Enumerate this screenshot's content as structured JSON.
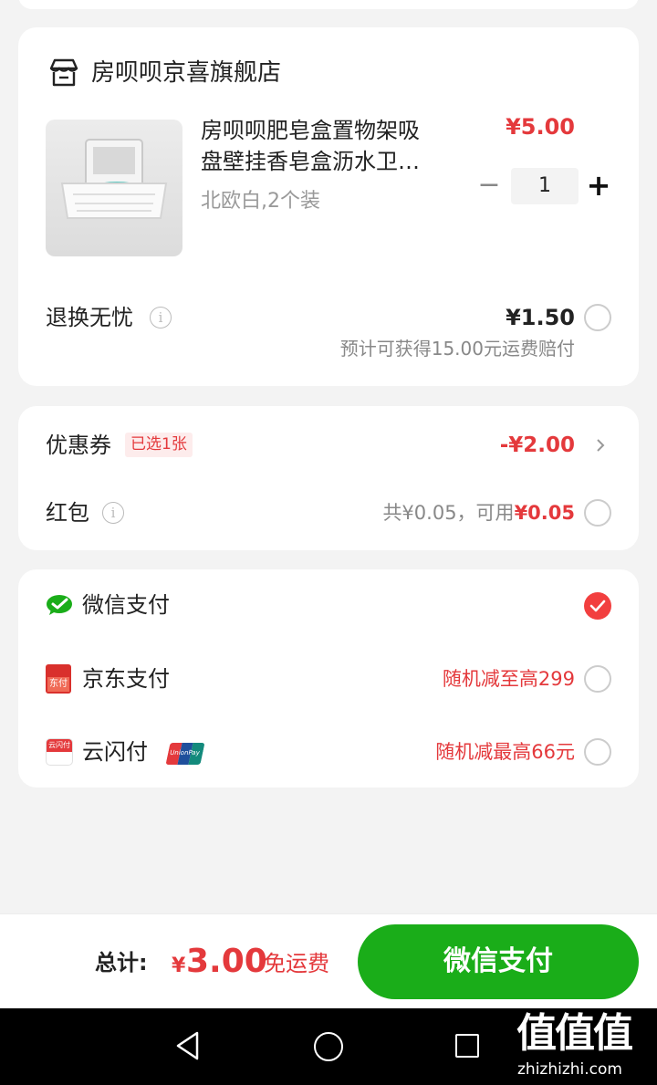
{
  "store": {
    "name": "房呗呗京喜旗舰店",
    "product": {
      "title_line1": "房呗呗肥皂盒置物架吸",
      "title_line2": "盘壁挂香皂盒沥水卫…",
      "spec": "北欧白,2个装",
      "price": "¥5.00",
      "quantity": "1",
      "minus": "−",
      "plus": "+"
    },
    "return_service": {
      "label": "退换无忧",
      "price": "¥1.50",
      "note": "预计可获得15.00元运费赔付"
    }
  },
  "discounts": {
    "coupon_label": "优惠券",
    "coupon_badge": "已选1张",
    "coupon_value": "-¥2.00",
    "redpacket_label": "红包",
    "redpacket_total": "共¥0.05，可用",
    "redpacket_available": "¥0.05"
  },
  "payment": {
    "options": [
      {
        "label": "微信支付",
        "promo": "",
        "selected": true
      },
      {
        "label": "京东支付",
        "promo": "随机减至高299",
        "selected": false
      },
      {
        "label": "云闪付",
        "promo": "随机减最高66元",
        "selected": false
      }
    ],
    "jd_icon_text": "东付",
    "ysf_icon_text": "云闪付",
    "unionpay_text": "UnionPay"
  },
  "footer": {
    "total_label": "总计:",
    "currency": "¥",
    "total_value": "3.00",
    "shipping": "免运费",
    "pay_button": "微信支付"
  },
  "watermark": {
    "logo": "值值值",
    "site": "zhizhizhi.com"
  },
  "colors": {
    "accent_red": "#e4393c",
    "wechat_green": "#1aad19"
  }
}
